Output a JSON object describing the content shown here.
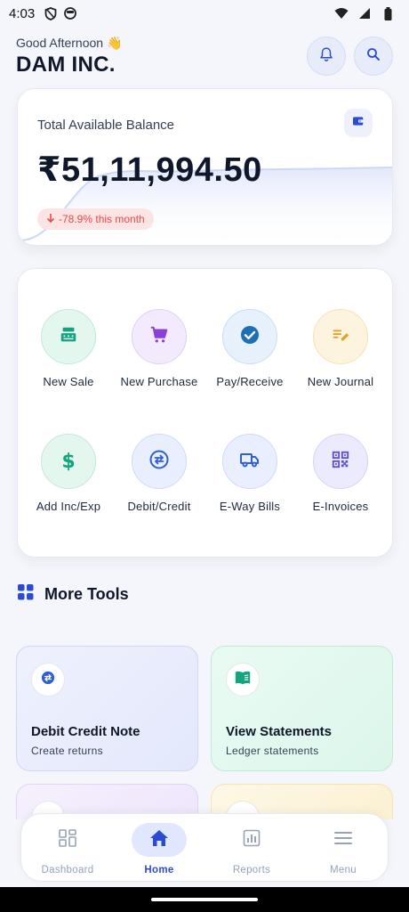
{
  "status": {
    "time": "4:03"
  },
  "header": {
    "greeting": "Good Afternoon 👋",
    "company": "DAM INC."
  },
  "balance": {
    "label": "Total Available Balance",
    "amount": "₹51,11,994.50",
    "trend": "-78.9% this month"
  },
  "actions": [
    {
      "label": "New Sale",
      "icon": "cash-register-icon",
      "color": "#14a37f"
    },
    {
      "label": "New Purchase",
      "icon": "cart-icon",
      "color": "#8b3fd9"
    },
    {
      "label": "Pay/Receive",
      "icon": "check-circle-icon",
      "color": "#1d6fb8"
    },
    {
      "label": "New Journal",
      "icon": "edit-note-icon",
      "color": "#e0a22a"
    },
    {
      "label": "Add Inc/Exp",
      "icon": "dollar-icon",
      "color": "#14a37f"
    },
    {
      "label": "Debit/Credit",
      "icon": "swap-icon",
      "color": "#2f5fd0"
    },
    {
      "label": "E-Way Bills",
      "icon": "truck-icon",
      "color": "#2f5fd0"
    },
    {
      "label": "E-Invoices",
      "icon": "qr-code-icon",
      "color": "#5b4fd6"
    }
  ],
  "more_tools": {
    "title": "More Tools",
    "items": [
      {
        "title": "Debit Credit Note",
        "subtitle": "Create returns",
        "icon": "swap-icon"
      },
      {
        "title": "View Statements",
        "subtitle": "Ledger statements",
        "icon": "book-icon"
      }
    ]
  },
  "nav": {
    "items": [
      {
        "label": "Dashboard",
        "icon": "dashboard-icon"
      },
      {
        "label": "Home",
        "icon": "home-icon",
        "active": true
      },
      {
        "label": "Reports",
        "icon": "reports-icon"
      },
      {
        "label": "Menu",
        "icon": "menu-icon"
      }
    ]
  },
  "colors": {
    "accent": "#2b4bd1",
    "negative": "#e24b4b",
    "page_bg": "#f4f6fb"
  }
}
